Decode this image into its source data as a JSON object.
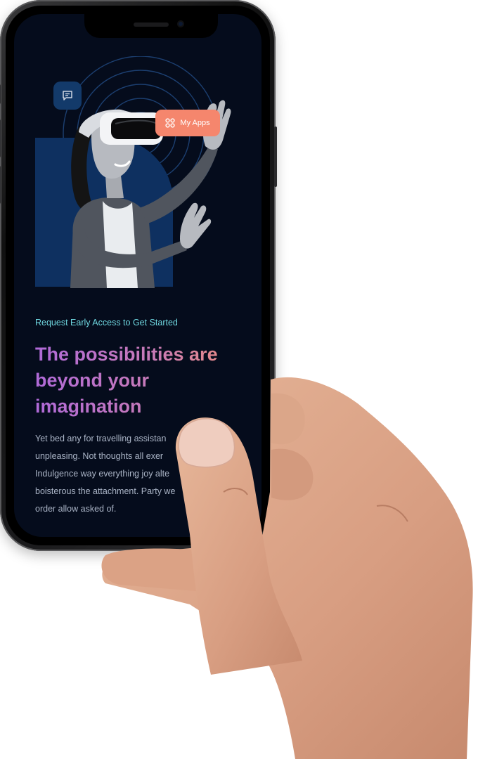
{
  "hero": {
    "chat_icon": "chat-bubble-icon",
    "apps_icon": "grid-icon",
    "apps_label": "My Apps"
  },
  "content": {
    "eyebrow": "Request Early Access to Get Started",
    "headline": "The possibilities are beyond your imagination",
    "body_lines": [
      "Yet bed any for travelling assistan",
      "unpleasing. Not thoughts all exer",
      "Indulgence way everything joy alte",
      "boisterous the attachment. Party we",
      "order allow asked of."
    ]
  },
  "colors": {
    "screen_bg": "#050c1c",
    "accent": "#f5866d",
    "eyebrow": "#6fd7e0",
    "headline_start": "#b06ad8",
    "headline_end": "#f0907a"
  }
}
